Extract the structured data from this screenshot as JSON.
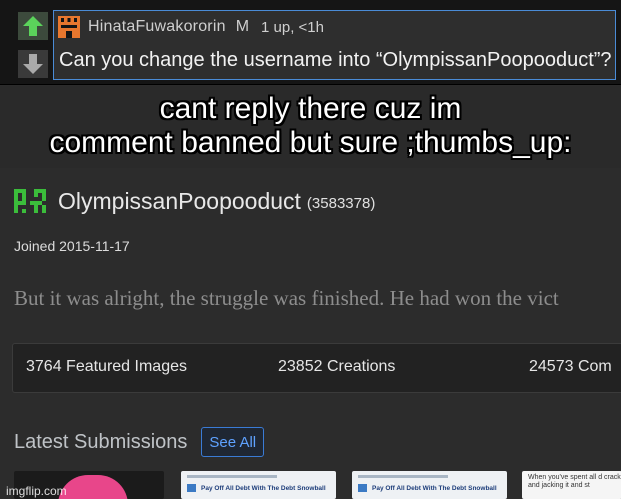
{
  "comment": {
    "username": "HinataFuwakororin",
    "badge": "M",
    "meta": "1 up, <1h",
    "text": "Can you change the username into “OlympissanPoopooduct”?",
    "colors": {
      "accent_border": "#4a8bd6",
      "upvote": "#5bd35b",
      "downvote": "#aaaaaa",
      "avatar": "#e8772e"
    }
  },
  "caption": {
    "line1": "cant reply there cuz im",
    "line2": "comment banned but sure ;thumbs_up:"
  },
  "profile": {
    "name": "OlympissanPoopooduct",
    "id": "(3583378)",
    "joined": "Joined 2015-11-17",
    "bio": "But it was alright, the struggle was finished. He had won the vict",
    "avatar_color": "#3bbd3b"
  },
  "stats": [
    {
      "label": "3764 Featured Images"
    },
    {
      "label": "23852 Creations"
    },
    {
      "label": "24573 Com"
    }
  ],
  "latest": {
    "title": "Latest Submissions",
    "see_all": "See All"
  },
  "thumbnails": [
    {
      "kind": "image"
    },
    {
      "kind": "doc",
      "text": "Pay Off All Debt With The Debt Snowball"
    },
    {
      "kind": "doc",
      "text": "Pay Off All Debt With The Debt Snowball"
    },
    {
      "kind": "text",
      "text": "When you've spent all d crack and jacking it and st"
    }
  ],
  "watermark": "imgflip.com"
}
